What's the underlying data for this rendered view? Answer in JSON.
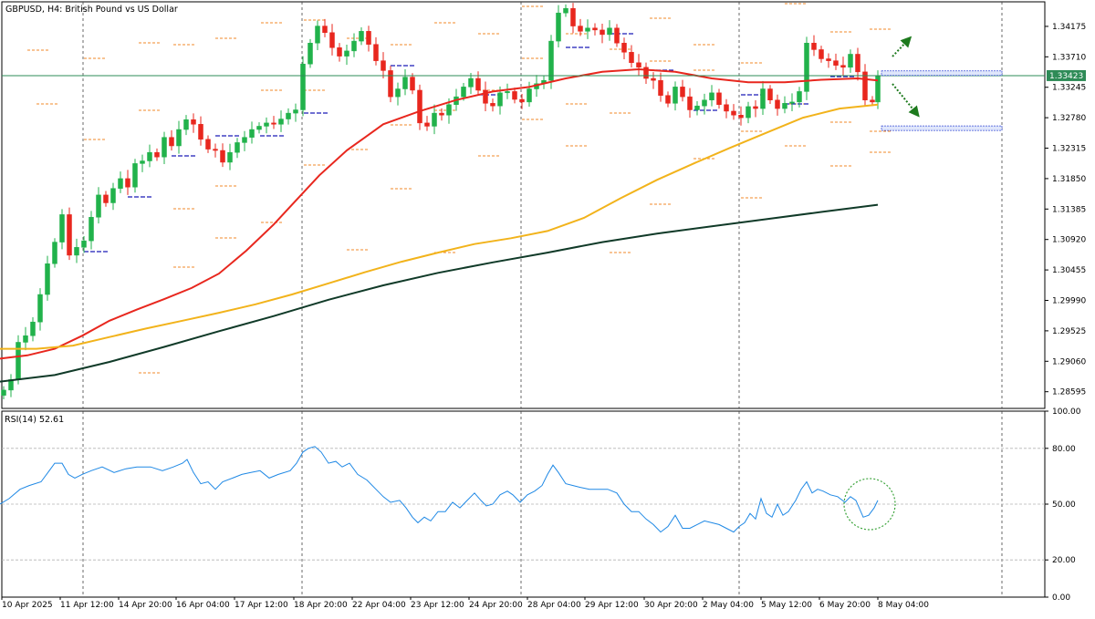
{
  "chart_data": [
    {
      "type": "candlestick",
      "title": "GBPUSD, H4:  British Pound vs US Dollar",
      "y_ticks": [
        "1.34175",
        "1.33710",
        "1.33245",
        "1.32780",
        "1.32315",
        "1.31850",
        "1.31385",
        "1.30920",
        "1.30455",
        "1.29990",
        "1.29525",
        "1.29060",
        "1.28595"
      ],
      "y_ticks_values": [
        1.34175,
        1.3371,
        1.33245,
        1.3278,
        1.32315,
        1.3185,
        1.31385,
        1.3092,
        1.30455,
        1.2999,
        1.29525,
        1.2906,
        1.28595
      ],
      "ylim": [
        1.2834,
        1.3455
      ],
      "current_price": "1.33423",
      "current_price_value": 1.33423,
      "x_ticks": [
        "10 Apr 2025",
        "11 Apr 12:00",
        "14 Apr 20:00",
        "16 Apr 04:00",
        "17 Apr 12:00",
        "18 Apr 20:00",
        "22 Apr 04:00",
        "23 Apr 12:00",
        "24 Apr 20:00",
        "28 Apr 04:00",
        "29 Apr 12:00",
        "30 Apr 20:00",
        "2 May 04:00",
        "5 May 12:00",
        "6 May 20:00",
        "8 May 04:00"
      ],
      "series": [
        {
          "name": "",
          "color": "#e8271e",
          "role": "moving-average",
          "values": [
            [
              0,
              1.291
            ],
            [
              30,
              1.2915
            ],
            [
              60,
              1.2925
            ],
            [
              90,
              1.2945
            ],
            [
              120,
              1.2968
            ],
            [
              150,
              1.2985
            ],
            [
              180,
              1.3001
            ],
            [
              210,
              1.3018
            ],
            [
              240,
              1.304
            ],
            [
              270,
              1.3075
            ],
            [
              300,
              1.3115
            ],
            [
              320,
              1.3145
            ],
            [
              350,
              1.319
            ],
            [
              380,
              1.3228
            ],
            [
              400,
              1.3248
            ],
            [
              420,
              1.3268
            ],
            [
              460,
              1.3288
            ],
            [
              500,
              1.3305
            ],
            [
              540,
              1.3318
            ],
            [
              580,
              1.3325
            ],
            [
              620,
              1.3338
            ],
            [
              660,
              1.3348
            ],
            [
              700,
              1.3352
            ],
            [
              740,
              1.3348
            ],
            [
              780,
              1.3338
            ],
            [
              820,
              1.3332
            ],
            [
              860,
              1.3332
            ],
            [
              900,
              1.3336
            ],
            [
              940,
              1.3338
            ],
            [
              962,
              1.3335
            ]
          ]
        },
        {
          "name": "",
          "color": "#f2b31b",
          "role": "moving-average",
          "values": [
            [
              0,
              1.2925
            ],
            [
              40,
              1.2925
            ],
            [
              80,
              1.293
            ],
            [
              120,
              1.2943
            ],
            [
              160,
              1.2956
            ],
            [
              200,
              1.2968
            ],
            [
              240,
              1.298
            ],
            [
              280,
              1.2993
            ],
            [
              320,
              1.3008
            ],
            [
              360,
              1.3025
            ],
            [
              400,
              1.3042
            ],
            [
              440,
              1.3058
            ],
            [
              480,
              1.3072
            ],
            [
              520,
              1.3085
            ],
            [
              560,
              1.3094
            ],
            [
              600,
              1.3105
            ],
            [
              640,
              1.3125
            ],
            [
              680,
              1.3155
            ],
            [
              720,
              1.3183
            ],
            [
              760,
              1.3208
            ],
            [
              800,
              1.3232
            ],
            [
              840,
              1.3255
            ],
            [
              880,
              1.3278
            ],
            [
              920,
              1.3292
            ],
            [
              962,
              1.3298
            ]
          ]
        },
        {
          "name": "",
          "color": "#103a28",
          "role": "moving-average",
          "values": [
            [
              0,
              1.2875
            ],
            [
              60,
              1.2885
            ],
            [
              120,
              1.2905
            ],
            [
              180,
              1.2928
            ],
            [
              240,
              1.2952
            ],
            [
              300,
              1.2975
            ],
            [
              360,
              1.3
            ],
            [
              420,
              1.3022
            ],
            [
              480,
              1.3041
            ],
            [
              540,
              1.3057
            ],
            [
              600,
              1.3072
            ],
            [
              660,
              1.3088
            ],
            [
              720,
              1.3101
            ],
            [
              780,
              1.3112
            ],
            [
              840,
              1.3123
            ],
            [
              900,
              1.3134
            ],
            [
              962,
              1.3145
            ]
          ]
        }
      ],
      "annotations": {
        "horizontal_line_price": 1.33423,
        "zones": [
          {
            "price": 1.3346
          },
          {
            "price": 1.3262
          }
        ],
        "arrows": [
          "up",
          "down"
        ]
      }
    },
    {
      "type": "line",
      "title": "RSI(14) 52.61",
      "y_ticks": [
        "100.00",
        "80.00",
        "50.00",
        "20.00",
        "0.00"
      ],
      "y_ticks_values": [
        100,
        80,
        50,
        20,
        0
      ],
      "ylim": [
        0,
        100
      ],
      "levels": [
        80,
        50,
        20
      ],
      "series": [
        {
          "name": "",
          "color": "#1e88e5",
          "values": [
            [
              0,
              50
            ],
            [
              10,
              53
            ],
            [
              22,
              58
            ],
            [
              32,
              60
            ],
            [
              45,
              62
            ],
            [
              54,
              68
            ],
            [
              60,
              72
            ],
            [
              68,
              72
            ],
            [
              75,
              66
            ],
            [
              82,
              64
            ],
            [
              90,
              66
            ],
            [
              100,
              68
            ],
            [
              112,
              70
            ],
            [
              125,
              67
            ],
            [
              138,
              69
            ],
            [
              150,
              70
            ],
            [
              165,
              70
            ],
            [
              178,
              68
            ],
            [
              190,
              70
            ],
            [
              200,
              72
            ],
            [
              205,
              74
            ],
            [
              212,
              67
            ],
            [
              220,
              61
            ],
            [
              228,
              62
            ],
            [
              236,
              58
            ],
            [
              244,
              62
            ],
            [
              255,
              64
            ],
            [
              265,
              66
            ],
            [
              275,
              67
            ],
            [
              285,
              68
            ],
            [
              295,
              64
            ],
            [
              305,
              66
            ],
            [
              318,
              68
            ],
            [
              325,
              72
            ],
            [
              332,
              78
            ],
            [
              338,
              80
            ],
            [
              345,
              81
            ],
            [
              352,
              78
            ],
            [
              360,
              72
            ],
            [
              368,
              73
            ],
            [
              375,
              70
            ],
            [
              383,
              72
            ],
            [
              392,
              66
            ],
            [
              402,
              63
            ],
            [
              412,
              58
            ],
            [
              420,
              54
            ],
            [
              428,
              51
            ],
            [
              438,
              52
            ],
            [
              445,
              48
            ],
            [
              452,
              43
            ],
            [
              458,
              40
            ],
            [
              465,
              43
            ],
            [
              472,
              41
            ],
            [
              480,
              46
            ],
            [
              488,
              46
            ],
            [
              496,
              51
            ],
            [
              504,
              48
            ],
            [
              512,
              52
            ],
            [
              520,
              56
            ],
            [
              527,
              52
            ],
            [
              533,
              49
            ],
            [
              540,
              50
            ],
            [
              548,
              55
            ],
            [
              556,
              57
            ],
            [
              562,
              55
            ],
            [
              570,
              51
            ],
            [
              578,
              55
            ],
            [
              586,
              57
            ],
            [
              594,
              60
            ],
            [
              600,
              66
            ],
            [
              606,
              71
            ],
            [
              612,
              67
            ],
            [
              620,
              61
            ],
            [
              628,
              60
            ],
            [
              636,
              59
            ],
            [
              646,
              58
            ],
            [
              656,
              58
            ],
            [
              666,
              58
            ],
            [
              676,
              56
            ],
            [
              684,
              50
            ],
            [
              692,
              46
            ],
            [
              700,
              46
            ],
            [
              708,
              42
            ],
            [
              716,
              39
            ],
            [
              724,
              35
            ],
            [
              732,
              38
            ],
            [
              740,
              44
            ],
            [
              748,
              37
            ],
            [
              756,
              37
            ],
            [
              764,
              39
            ],
            [
              772,
              41
            ],
            [
              780,
              40
            ],
            [
              788,
              39
            ],
            [
              796,
              37
            ],
            [
              804,
              35
            ],
            [
              810,
              38
            ],
            [
              816,
              40
            ],
            [
              822,
              45
            ],
            [
              828,
              42
            ],
            [
              834,
              53
            ],
            [
              840,
              45
            ],
            [
              846,
              43
            ],
            [
              852,
              50
            ],
            [
              858,
              44
            ],
            [
              864,
              46
            ],
            [
              872,
              52
            ],
            [
              878,
              58
            ],
            [
              884,
              62
            ],
            [
              890,
              56
            ],
            [
              896,
              58
            ],
            [
              902,
              57
            ],
            [
              910,
              55
            ],
            [
              918,
              54
            ],
            [
              926,
              51
            ],
            [
              932,
              54
            ],
            [
              938,
              52
            ],
            [
              946,
              43
            ],
            [
              952,
              44
            ],
            [
              958,
              48
            ],
            [
              962,
              52
            ]
          ]
        }
      ]
    }
  ]
}
